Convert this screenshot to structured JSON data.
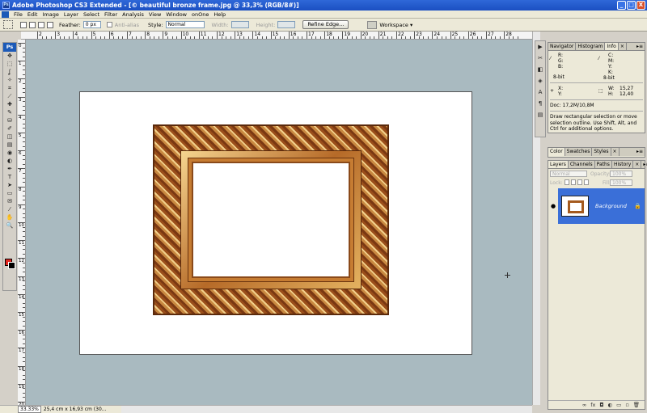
{
  "window": {
    "title": "Adobe Photoshop CS3 Extended - [© beautiful bronze frame.jpg @ 33,3% (RGB/8#)]",
    "buttons": {
      "minimize": "_",
      "maximize": "□",
      "close": "X"
    }
  },
  "menu": [
    "File",
    "Edit",
    "Image",
    "Layer",
    "Select",
    "Filter",
    "Analysis",
    "View",
    "Window",
    "onOne",
    "Help"
  ],
  "options": {
    "feather_label": "Feather:",
    "feather_value": "0 px",
    "antialias_label": "Anti-alias",
    "style_label": "Style:",
    "style_value": "Normal",
    "width_label": "Width:",
    "height_label": "Height:",
    "refine_edge": "Refine Edge...",
    "workspace": "Workspace ▾"
  },
  "ruler_top": [
    "2",
    "3",
    "4",
    "5",
    "6",
    "7",
    "8",
    "9",
    "10",
    "11",
    "12",
    "13",
    "14",
    "15",
    "16",
    "17",
    "18",
    "19",
    "20",
    "21",
    "22",
    "23",
    "24",
    "25",
    "26",
    "27",
    "28"
  ],
  "ruler_left": [
    "0",
    "1",
    "2",
    "3",
    "4",
    "5",
    "6",
    "7",
    "8",
    "9",
    "10",
    "11",
    "12",
    "13",
    "14",
    "15",
    "16",
    "17",
    "18",
    "19",
    "20"
  ],
  "toolbox": {
    "logo": "Ps",
    "tools": [
      "move-icon",
      "marquee-icon",
      "lasso-icon",
      "magic-wand-icon",
      "crop-icon",
      "slice-icon",
      "healing-icon",
      "brush-icon",
      "stamp-icon",
      "history-brush-icon",
      "eraser-icon",
      "gradient-icon",
      "blur-icon",
      "dodge-icon",
      "pen-icon",
      "type-icon",
      "path-select-icon",
      "shape-icon",
      "notes-icon",
      "eyedropper-icon",
      "hand-icon",
      "zoom-icon"
    ],
    "tool_glyphs": [
      "✥",
      "⬚",
      "ʆ",
      "✧",
      "⌗",
      "⟋",
      "✚",
      "✎",
      "⛁",
      "✐",
      "◫",
      "▤",
      "◉",
      "◐",
      "✒",
      "T",
      "➤",
      "▭",
      "✉",
      "⁄",
      "✋",
      "🔍"
    ],
    "fg_color": "#e2261f",
    "bg_color": "#000000"
  },
  "status": {
    "zoom": "33.33%",
    "doc_size": "25,4 cm x 16,93 cm (30..."
  },
  "info_panel": {
    "tabs": [
      "Navigator",
      "Histogram",
      "Info"
    ],
    "active_tab": "Info",
    "close": "×",
    "menu": "▸≡",
    "rgb": [
      "R:",
      "G:",
      "B:"
    ],
    "cmyk": [
      "C:",
      "M:",
      "Y:",
      "K:"
    ],
    "bit_left": "8-bit",
    "bit_right": "8-bit",
    "xy": [
      "X:",
      "Y:"
    ],
    "w_label": "W:",
    "w_value": "15,27",
    "h_label": "H:",
    "h_value": "12,40",
    "doc": "Doc: 17,2M/10,8M",
    "description": "Draw rectangular selection or move selection outline.  Use Shift, Alt, and Ctrl for additional options."
  },
  "color_panel": {
    "tabs": [
      "Color",
      "Swatches",
      "Styles"
    ],
    "close": "×",
    "menu": "▸≡"
  },
  "layers_panel": {
    "tabs": [
      "Layers",
      "Channels",
      "Paths",
      "History"
    ],
    "close": "×",
    "menu": "▸≡",
    "blend_mode": "Normal",
    "opacity_label": "Opacity:",
    "opacity_value": "100%",
    "lock_label": "Lock:",
    "fill_label": "Fill:",
    "fill_value": "100%",
    "layer_name": "Background",
    "footer_icons": [
      "∞",
      "fx",
      "◘",
      "◐",
      "▭",
      "▫",
      "🗑"
    ]
  }
}
